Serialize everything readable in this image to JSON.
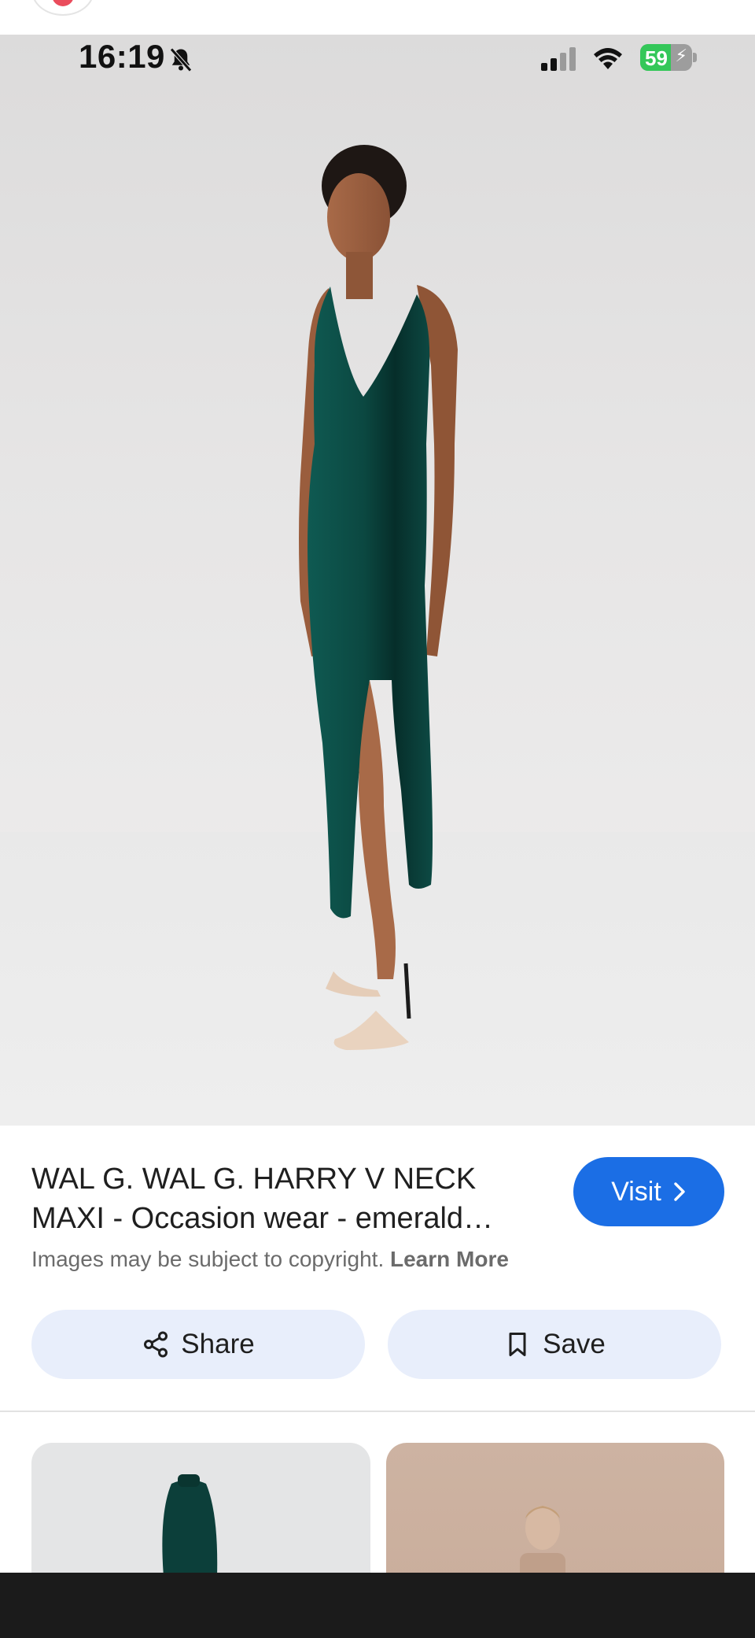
{
  "status_bar": {
    "time": "16:19",
    "battery_level": "59",
    "battery_fraction": 0.59,
    "icons": [
      "bell-slash-icon",
      "signal-icon",
      "wifi-icon",
      "battery-charging-icon"
    ]
  },
  "product": {
    "title": "WAL G. WAL G. HARRY V NECK MAXI - Occasion wear - emerald…",
    "visit_label": "Visit",
    "copyright_text": "Images may be subject to copyright.",
    "learn_more_label": "Learn More"
  },
  "actions": {
    "share_label": "Share",
    "save_label": "Save"
  },
  "colors": {
    "accent": "#1b6ee5",
    "action_bg": "#e8eefb",
    "battery_green": "#34c759",
    "dress": "#0d4a44"
  }
}
